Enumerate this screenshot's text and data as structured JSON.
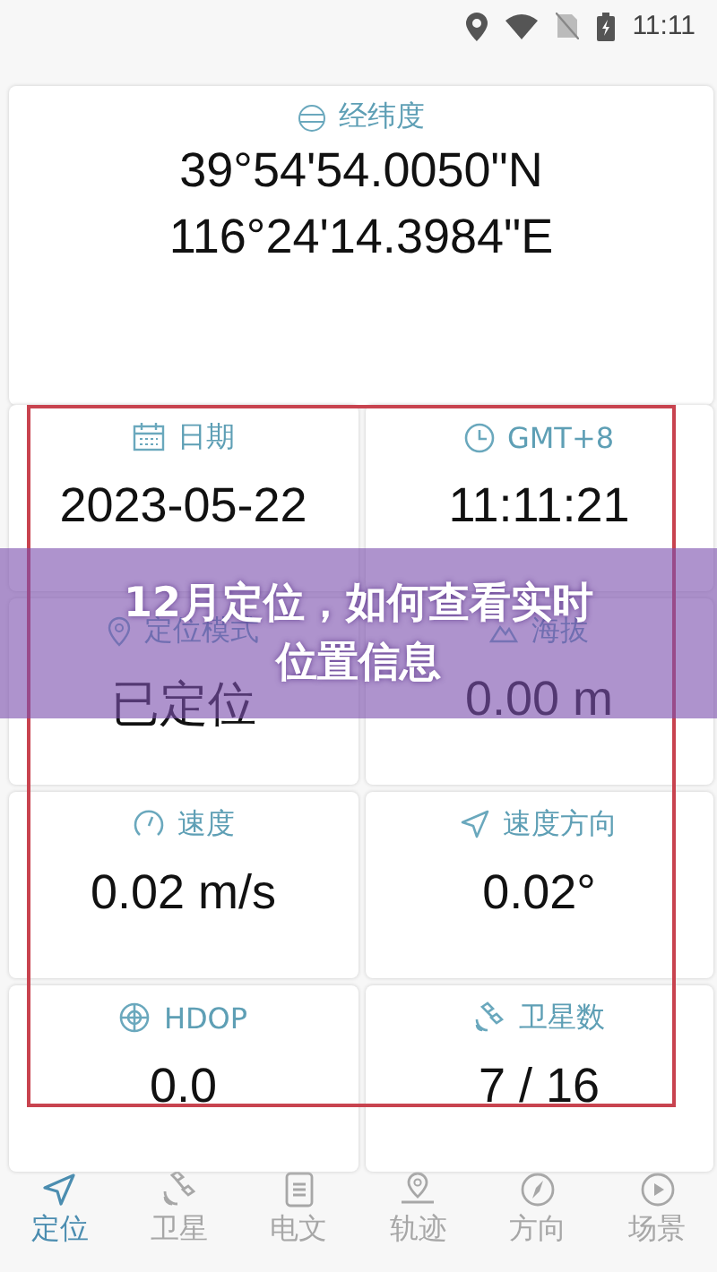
{
  "status_bar": {
    "time": "11:11"
  },
  "coordinates": {
    "label": "经纬度",
    "latitude": "39°54'54.0050\"N",
    "longitude": "116°24'14.3984\"E"
  },
  "cells": [
    {
      "label": "日期",
      "value": "2023-05-22"
    },
    {
      "label": "GMT+8",
      "value": "11:11:21"
    },
    {
      "label": "定位模式",
      "value": "已定位"
    },
    {
      "label": "海拔",
      "value": "0.00 m"
    },
    {
      "label": "速度",
      "value": "0.02 m/s"
    },
    {
      "label": "速度方向",
      "value": "0.02°"
    },
    {
      "label": "HDOP",
      "value": "0.0"
    },
    {
      "label": "卫星数",
      "value": "7 / 16"
    }
  ],
  "banner": {
    "title": "12月定位，如何查看实时位置信息"
  },
  "tabs": [
    {
      "label": "定位",
      "selected": true
    },
    {
      "label": "卫星",
      "selected": false
    },
    {
      "label": "电文",
      "selected": false
    },
    {
      "label": "轨迹",
      "selected": false
    },
    {
      "label": "方向",
      "selected": false
    },
    {
      "label": "场景",
      "selected": false
    }
  ]
}
